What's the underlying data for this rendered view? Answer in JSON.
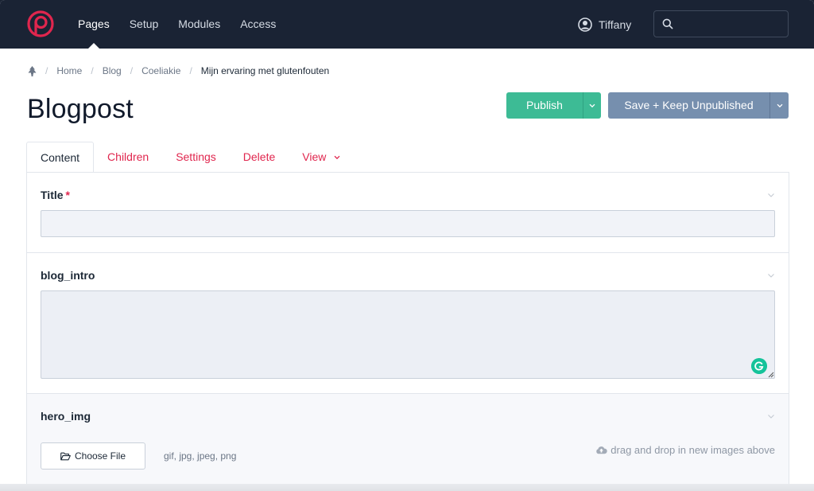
{
  "nav": {
    "items": [
      {
        "label": "Pages",
        "active": true
      },
      {
        "label": "Setup",
        "active": false
      },
      {
        "label": "Modules",
        "active": false
      },
      {
        "label": "Access",
        "active": false
      }
    ],
    "user": "Tiffany",
    "search_placeholder": ""
  },
  "breadcrumb": {
    "home_icon": "tree-icon",
    "items": [
      "Home",
      "Blog",
      "Coeliakie",
      "Mijn ervaring met glutenfouten"
    ]
  },
  "page": {
    "title": "Blogpost"
  },
  "actions": {
    "publish_label": "Publish",
    "save_label": "Save + Keep Unpublished"
  },
  "tabs": [
    {
      "label": "Content",
      "active": true
    },
    {
      "label": "Children"
    },
    {
      "label": "Settings"
    },
    {
      "label": "Delete"
    },
    {
      "label": "View"
    }
  ],
  "fields": {
    "title": {
      "label": "Title",
      "required_mark": "*",
      "value": ""
    },
    "blog_intro": {
      "label": "blog_intro",
      "value": ""
    },
    "hero_img": {
      "label": "hero_img",
      "choose_file_label": "Choose File",
      "file_types": "gif, jpg, jpeg, png",
      "dropzone_text": "drag and drop in new images above"
    }
  },
  "colors": {
    "topbar": "#1a2334",
    "accent": "#e0264e",
    "publish": "#3dbb95",
    "save": "#768fae"
  }
}
